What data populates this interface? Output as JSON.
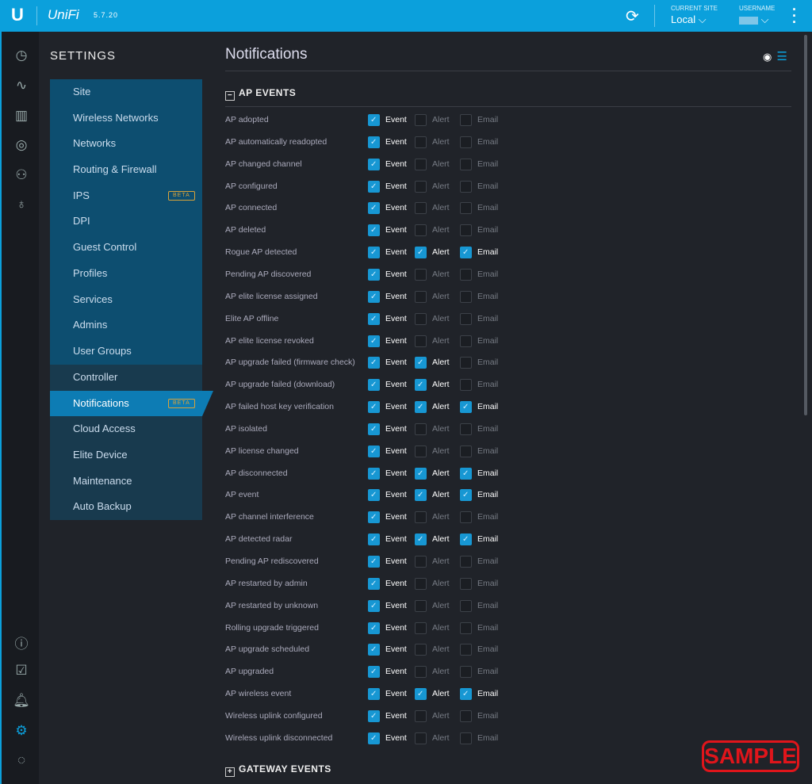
{
  "topbar": {
    "logo": "U",
    "brand": "UniFi",
    "version": "5.7.20",
    "current_site_label": "CURRENT SITE",
    "current_site": "Local",
    "username_label": "USERNAME"
  },
  "rail": [
    "dashboard-icon",
    "statistics-icon",
    "map-icon",
    "devices-icon",
    "clients-icon",
    "insights-icon"
  ],
  "rail_bottom": [
    "info-icon",
    "tasks-icon",
    "alerts-icon",
    "settings-icon",
    "chat-icon"
  ],
  "settings": {
    "title": "SETTINGS",
    "group1": [
      {
        "label": "Site"
      },
      {
        "label": "Wireless Networks"
      },
      {
        "label": "Networks"
      },
      {
        "label": "Routing & Firewall"
      },
      {
        "label": "IPS",
        "badge": "BETA"
      },
      {
        "label": "DPI"
      },
      {
        "label": "Guest Control"
      },
      {
        "label": "Profiles"
      },
      {
        "label": "Services"
      },
      {
        "label": "Admins"
      },
      {
        "label": "User Groups"
      }
    ],
    "group2": [
      {
        "label": "Controller"
      },
      {
        "label": "Notifications",
        "badge": "BETA",
        "selected": true
      },
      {
        "label": "Cloud Access"
      },
      {
        "label": "Elite Device"
      },
      {
        "label": "Maintenance"
      },
      {
        "label": "Auto Backup"
      }
    ]
  },
  "main": {
    "title": "Notifications",
    "ap_section": "AP EVENTS",
    "gateway_section": "GATEWAY EVENTS",
    "col_event": "Event",
    "col_alert": "Alert",
    "col_email": "Email",
    "rows": [
      {
        "name": "AP adopted",
        "event": true,
        "alert": false,
        "email": false
      },
      {
        "name": "AP automatically readopted",
        "event": true,
        "alert": false,
        "email": false
      },
      {
        "name": "AP changed channel",
        "event": true,
        "alert": false,
        "email": false
      },
      {
        "name": "AP configured",
        "event": true,
        "alert": false,
        "email": false
      },
      {
        "name": "AP connected",
        "event": true,
        "alert": false,
        "email": false
      },
      {
        "name": "AP deleted",
        "event": true,
        "alert": false,
        "email": false
      },
      {
        "name": "Rogue AP detected",
        "event": true,
        "alert": true,
        "email": true
      },
      {
        "name": "Pending AP discovered",
        "event": true,
        "alert": false,
        "email": false
      },
      {
        "name": "AP elite license assigned",
        "event": true,
        "alert": false,
        "email": false
      },
      {
        "name": "Elite AP offline",
        "event": true,
        "alert": false,
        "email": false
      },
      {
        "name": "AP elite license revoked",
        "event": true,
        "alert": false,
        "email": false
      },
      {
        "name": "AP upgrade failed (firmware check)",
        "event": true,
        "alert": true,
        "email": false
      },
      {
        "name": "AP upgrade failed (download)",
        "event": true,
        "alert": true,
        "email": false
      },
      {
        "name": "AP failed host key verification",
        "event": true,
        "alert": true,
        "email": true
      },
      {
        "name": "AP isolated",
        "event": true,
        "alert": false,
        "email": false
      },
      {
        "name": "AP license changed",
        "event": true,
        "alert": false,
        "email": false
      },
      {
        "name": "AP disconnected",
        "event": true,
        "alert": true,
        "email": true
      },
      {
        "name": "AP event",
        "event": true,
        "alert": true,
        "email": true
      },
      {
        "name": "AP channel interference",
        "event": true,
        "alert": false,
        "email": false
      },
      {
        "name": "AP detected radar",
        "event": true,
        "alert": true,
        "email": true
      },
      {
        "name": "Pending AP rediscovered",
        "event": true,
        "alert": false,
        "email": false
      },
      {
        "name": "AP restarted by admin",
        "event": true,
        "alert": false,
        "email": false
      },
      {
        "name": "AP restarted by unknown",
        "event": true,
        "alert": false,
        "email": false
      },
      {
        "name": "Rolling upgrade triggered",
        "event": true,
        "alert": false,
        "email": false
      },
      {
        "name": "AP upgrade scheduled",
        "event": true,
        "alert": false,
        "email": false
      },
      {
        "name": "AP upgraded",
        "event": true,
        "alert": false,
        "email": false
      },
      {
        "name": "AP wireless event",
        "event": true,
        "alert": true,
        "email": true
      },
      {
        "name": "Wireless uplink configured",
        "event": true,
        "alert": false,
        "email": false
      },
      {
        "name": "Wireless uplink disconnected",
        "event": true,
        "alert": false,
        "email": false
      }
    ]
  },
  "watermark": "SAMPLE"
}
